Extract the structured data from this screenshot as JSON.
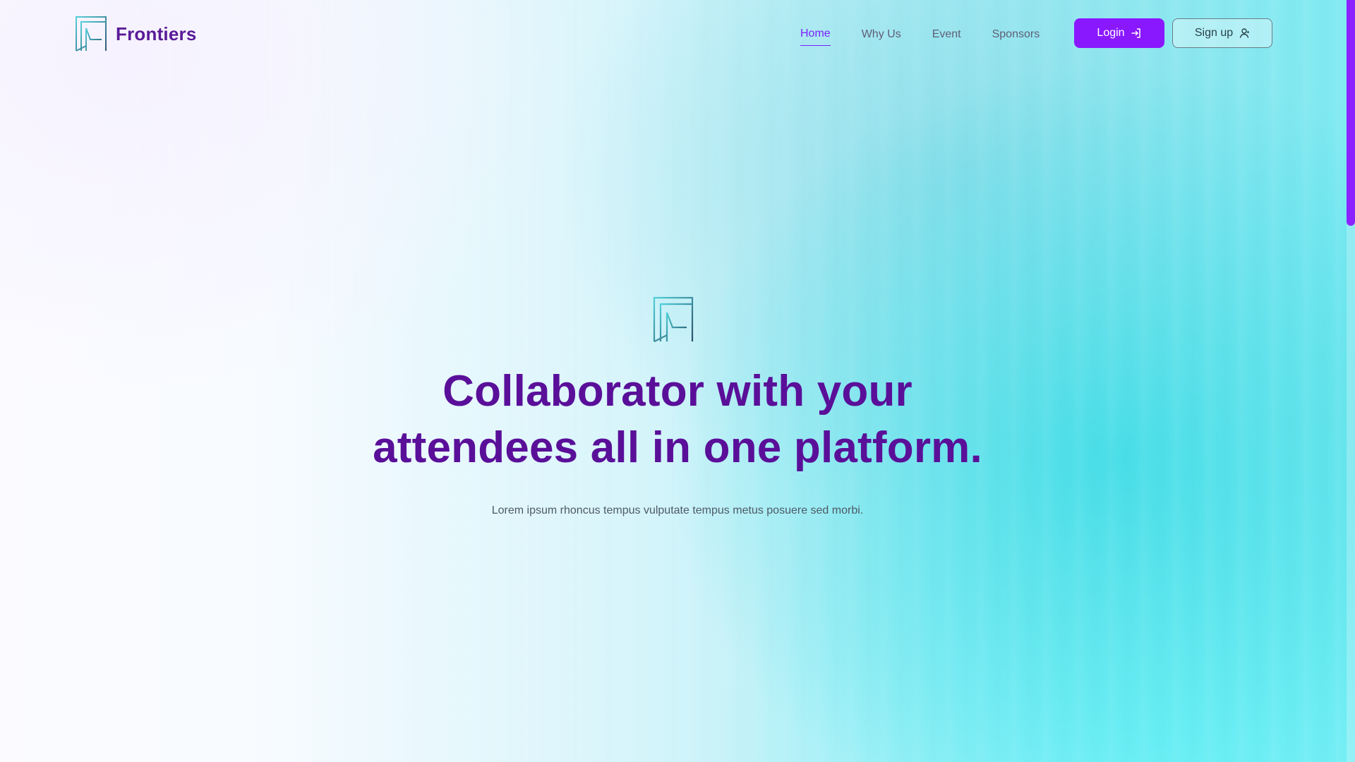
{
  "brand": {
    "name": "Frontiers",
    "logo_icon": "frontiers-logo-icon"
  },
  "nav": {
    "items": [
      {
        "label": "Home",
        "active": true
      },
      {
        "label": "Why Us",
        "active": false
      },
      {
        "label": "Event",
        "active": false
      },
      {
        "label": "Sponsors",
        "active": false
      }
    ]
  },
  "actions": {
    "login": {
      "label": "Login",
      "icon": "login-icon"
    },
    "signup": {
      "label": "Sign up",
      "icon": "user-icon"
    }
  },
  "hero": {
    "logo_icon": "frontiers-logo-icon",
    "title_line1": "Collaborator with your",
    "title_line2": "attendees all in one platform.",
    "subtitle": "Lorem ipsum rhoncus tempus vulputate tempus metus posuere sed morbi."
  },
  "colors": {
    "accent": "#8a18ff",
    "title": "#5a0f99",
    "nav_text": "#5f5f76"
  }
}
